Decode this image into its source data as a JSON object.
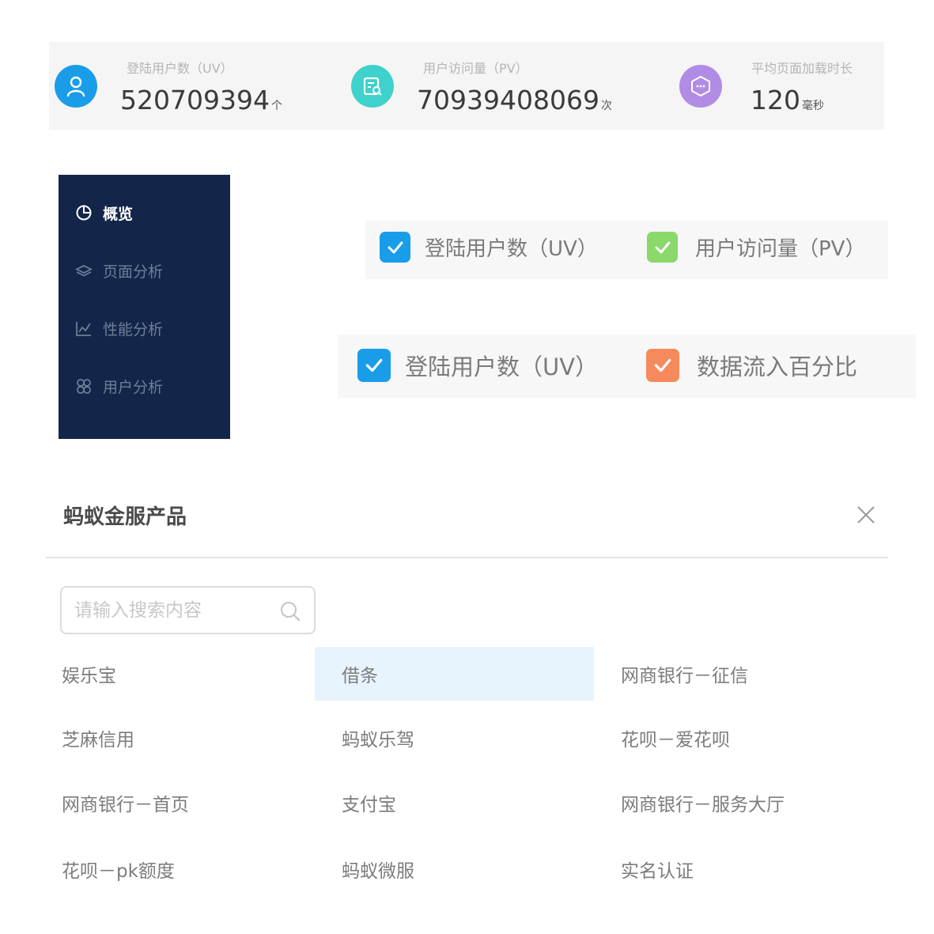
{
  "stats": [
    {
      "label": "登陆用户数（UV）",
      "value": "520709394",
      "unit": "个",
      "icon": "user-icon",
      "color": "#1a9de8"
    },
    {
      "label": "用户访问量（PV）",
      "value": "70939408069",
      "unit": "次",
      "icon": "document-search-icon",
      "color": "#3fd1cb"
    },
    {
      "label": "平均页面加载时长",
      "value": "120",
      "unit": "毫秒",
      "icon": "hexagon-icon",
      "color": "#b18ce4"
    }
  ],
  "sidebar": {
    "items": [
      {
        "label": "概览",
        "icon": "pie-chart-icon",
        "active": true
      },
      {
        "label": "页面分析",
        "icon": "layers-icon",
        "active": false
      },
      {
        "label": "性能分析",
        "icon": "line-chart-icon",
        "active": false
      },
      {
        "label": "用户分析",
        "icon": "users-icon",
        "active": false
      }
    ]
  },
  "legend_a": {
    "items": [
      {
        "label": "登陆用户数（UV）",
        "checked": true,
        "color": "#1a9de8"
      },
      {
        "label": "用户访问量（PV）",
        "checked": true,
        "color": "#8ad96a"
      }
    ]
  },
  "legend_b": {
    "items": [
      {
        "label": "登陆用户数（UV）",
        "checked": true,
        "color": "#1a9de8"
      },
      {
        "label": "数据流入百分比",
        "checked": true,
        "color": "#f78a5c"
      }
    ]
  },
  "dialog": {
    "title": "蚂蚁金服产品",
    "close_icon": "close-icon",
    "search_placeholder": "请输入搜索内容",
    "search_icon": "search-icon",
    "selected": "借条",
    "products": [
      "娱乐宝",
      "借条",
      "网商银行－征信",
      "芝麻信用",
      "蚂蚁乐驾",
      "花呗－爱花呗",
      "网商银行－首页",
      "支付宝",
      "网商银行－服务大厅",
      "花呗－pk额度",
      "蚂蚁微服",
      "实名认证"
    ]
  }
}
